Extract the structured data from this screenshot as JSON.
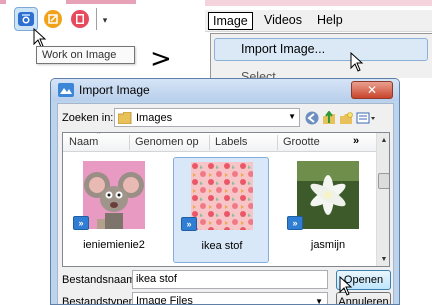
{
  "toolbar": {
    "tooltip": "Work on Image",
    "buttons": [
      "camera-icon",
      "edit-icon",
      "film-icon"
    ],
    "dropdown_glyph": "▾"
  },
  "separator_glyph": ">",
  "menu": {
    "items": [
      "Image",
      "Videos",
      "Help"
    ],
    "open_item": "Image",
    "dropdown_item": "Import Image...",
    "next_item_partial": "Select..."
  },
  "dialog": {
    "title": "Import Image",
    "close_glyph": "✕",
    "look_in_label": "Zoeken in:",
    "look_in_value": "Images",
    "columns": [
      "Naam",
      "Genomen op",
      "Labels",
      "Grootte"
    ],
    "more_columns": "»",
    "files": [
      {
        "name": "ieniemienie2",
        "selected": false,
        "badge": "»"
      },
      {
        "name": "ikea stof",
        "selected": true,
        "badge": "»"
      },
      {
        "name": "jasmijn",
        "selected": false,
        "badge": "»"
      }
    ],
    "filename_label": "Bestandsnaam:",
    "filename_value": "ikea stof",
    "filetype_label": "Bestandstypen:",
    "filetype_value": "Image Files",
    "open_label": "Openen",
    "cancel_label": "Annuleren"
  },
  "colors": {
    "selection_bg": "#d9e8f8",
    "title_bar": "#bcd3ee",
    "close_button": "#c9452c",
    "badge": "#2f7ed3"
  }
}
